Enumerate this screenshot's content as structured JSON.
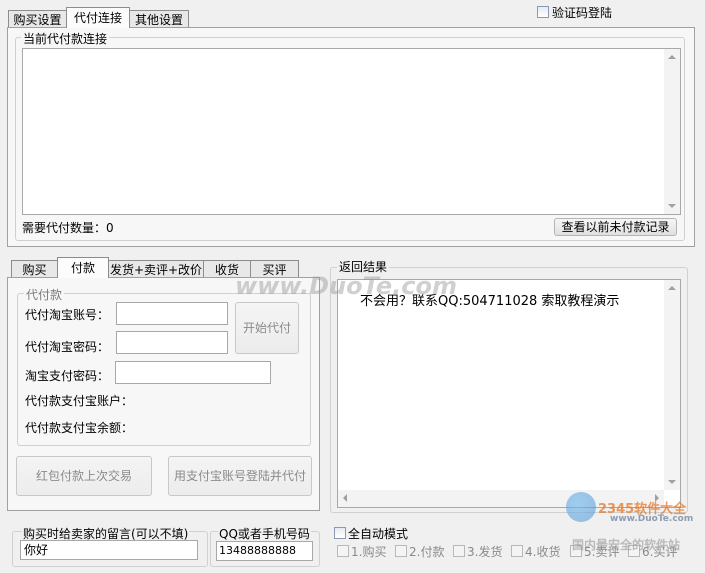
{
  "top_tabs": [
    "购买设置",
    "代付连接",
    "其他设置"
  ],
  "captcha_login": {
    "label": "验证码登陆",
    "checked": false
  },
  "connection_panel": {
    "title": "当前代付款连接",
    "count_label": "需要代付数量：",
    "count_value": "0",
    "history_button": "查看以前未付款记录"
  },
  "bottom_tabs": [
    "购买",
    "付款",
    "发货+卖评+改价",
    "收货",
    "买评"
  ],
  "payment_group": {
    "title": "代付款",
    "taobao_account_label": "代付淘宝账号：",
    "taobao_password_label": "代付淘宝密码：",
    "alipay_password_label": "淘宝支付密码：",
    "alipay_account_label": "代付款支付宝账户：",
    "alipay_balance_label": "代付款支付宝余额：",
    "start_button": "开始代付"
  },
  "action_buttons": {
    "red_packet": "红包付款上次交易",
    "alipay_login_pay": "用支付宝账号登陆并代付"
  },
  "result_panel": {
    "title": "返回结果",
    "text": "不会用？联系QQ:504711028  索取教程演示"
  },
  "message_group": {
    "label": "购买时给卖家的留言(可以不填)",
    "value": "你好"
  },
  "contact_group": {
    "label": "QQ或者手机号码",
    "value": "13488888888"
  },
  "auto_mode": {
    "label": "全自动模式",
    "checked": false,
    "steps": [
      "1.购买",
      "2.付款",
      "3.发货",
      "4.收货",
      "5.卖评",
      "6.买评"
    ]
  },
  "watermarks": {
    "main": "www.DuoTe.com",
    "brand": "2345软件大全",
    "site": "www.DuoTe.com",
    "slogan": "国内最安全的软件站"
  }
}
